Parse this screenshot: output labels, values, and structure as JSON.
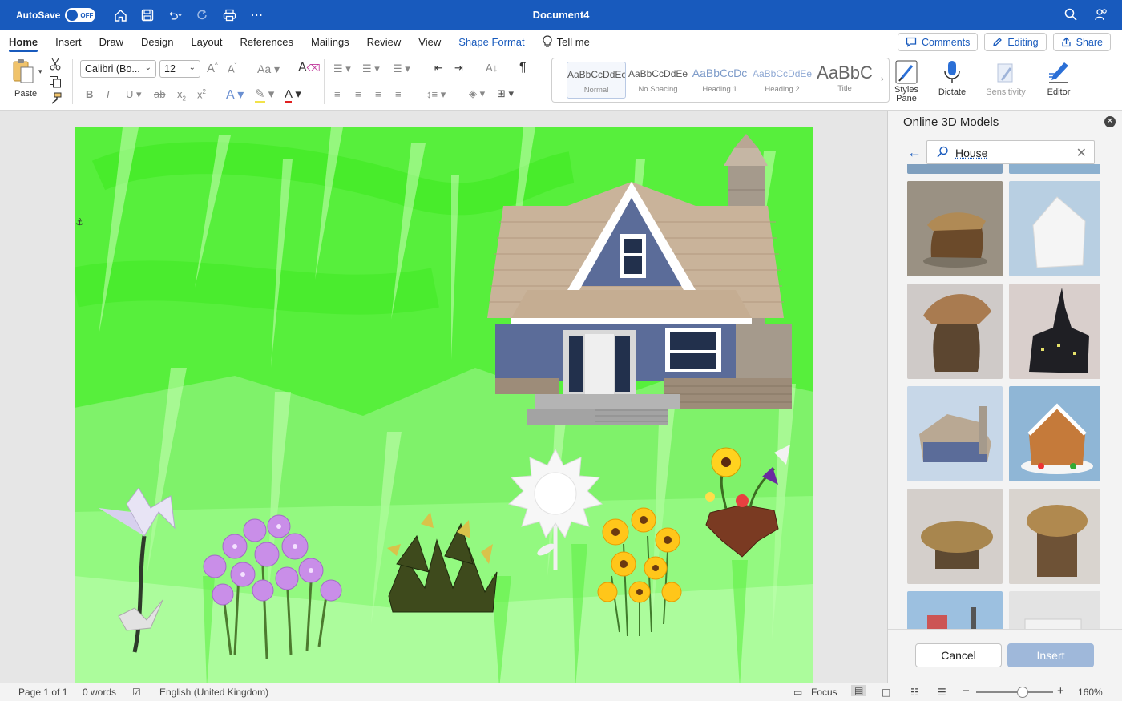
{
  "titlebar": {
    "autosave_label": "AutoSave",
    "autosave_state": "OFF",
    "document_title": "Document4"
  },
  "tabs": [
    {
      "label": "Home",
      "active": true
    },
    {
      "label": "Insert"
    },
    {
      "label": "Draw"
    },
    {
      "label": "Design"
    },
    {
      "label": "Layout"
    },
    {
      "label": "References"
    },
    {
      "label": "Mailings"
    },
    {
      "label": "Review"
    },
    {
      "label": "View"
    },
    {
      "label": "Shape Format",
      "contextual": true
    },
    {
      "label": "Tell me"
    }
  ],
  "tab_actions": {
    "comments": "Comments",
    "editing": "Editing",
    "share": "Share"
  },
  "ribbon": {
    "paste_label": "Paste",
    "font_name": "Calibri (Bo...",
    "font_size": "12",
    "styles": [
      {
        "sample": "AaBbCcDdEe",
        "name": "Normal"
      },
      {
        "sample": "AaBbCcDdEe",
        "name": "No Spacing"
      },
      {
        "sample": "AaBbCcDc",
        "name": "Heading 1"
      },
      {
        "sample": "AaBbCcDdEe",
        "name": "Heading 2"
      },
      {
        "sample": "AaBbC",
        "name": "Title"
      }
    ],
    "styles_pane_label": "Styles\nPane",
    "dictate_label": "Dictate",
    "sensitivity_label": "Sensitivity",
    "editor_label": "Editor"
  },
  "panel": {
    "title": "Online 3D Models",
    "search_value": "House",
    "cancel_label": "Cancel",
    "insert_label": "Insert"
  },
  "status": {
    "page": "Page 1 of 1",
    "words": "0 words",
    "language": "English (United Kingdom)",
    "focus": "Focus",
    "zoom": "160%",
    "zoom_fraction": 0.6
  },
  "colors": {
    "brand": "#185abd",
    "page_green": "#7ff26a"
  }
}
